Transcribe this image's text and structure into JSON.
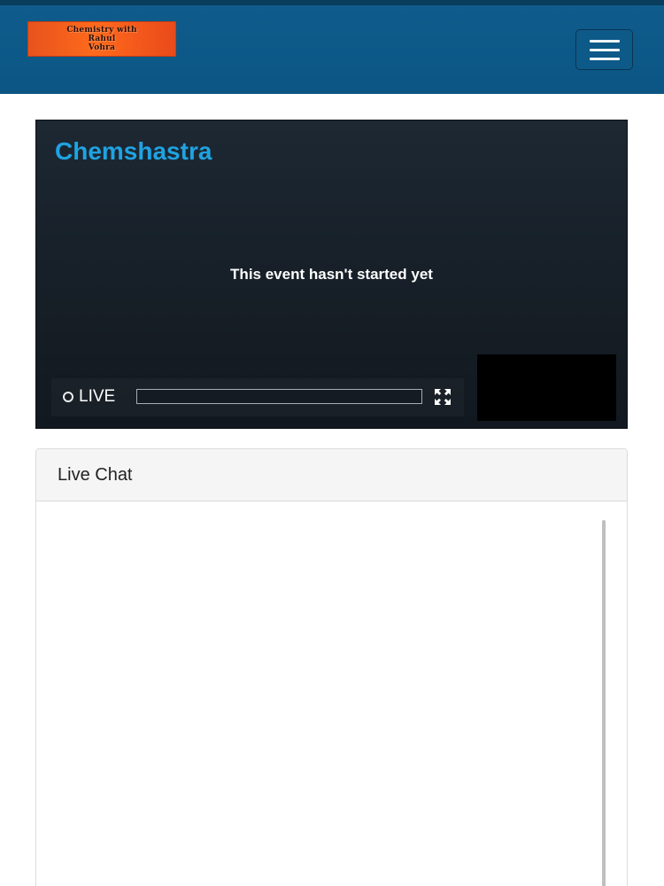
{
  "header": {
    "logo_lines": [
      "Chemistry with",
      "Rahul",
      "Vohra"
    ],
    "logo_colors": {
      "bg": "#f25c1f",
      "text": "#2a1006"
    },
    "bar_color": "#0c5887",
    "menu_icon": "hamburger-icon"
  },
  "player": {
    "title": "Chemshastra",
    "status_text": "This event hasn't started yet",
    "live_label": "LIVE",
    "progress": 0,
    "icons": {
      "live": "circle-icon",
      "fullscreen": "fullscreen-icon"
    },
    "title_color": "#1fa3e1"
  },
  "chat": {
    "title": "Live Chat"
  }
}
